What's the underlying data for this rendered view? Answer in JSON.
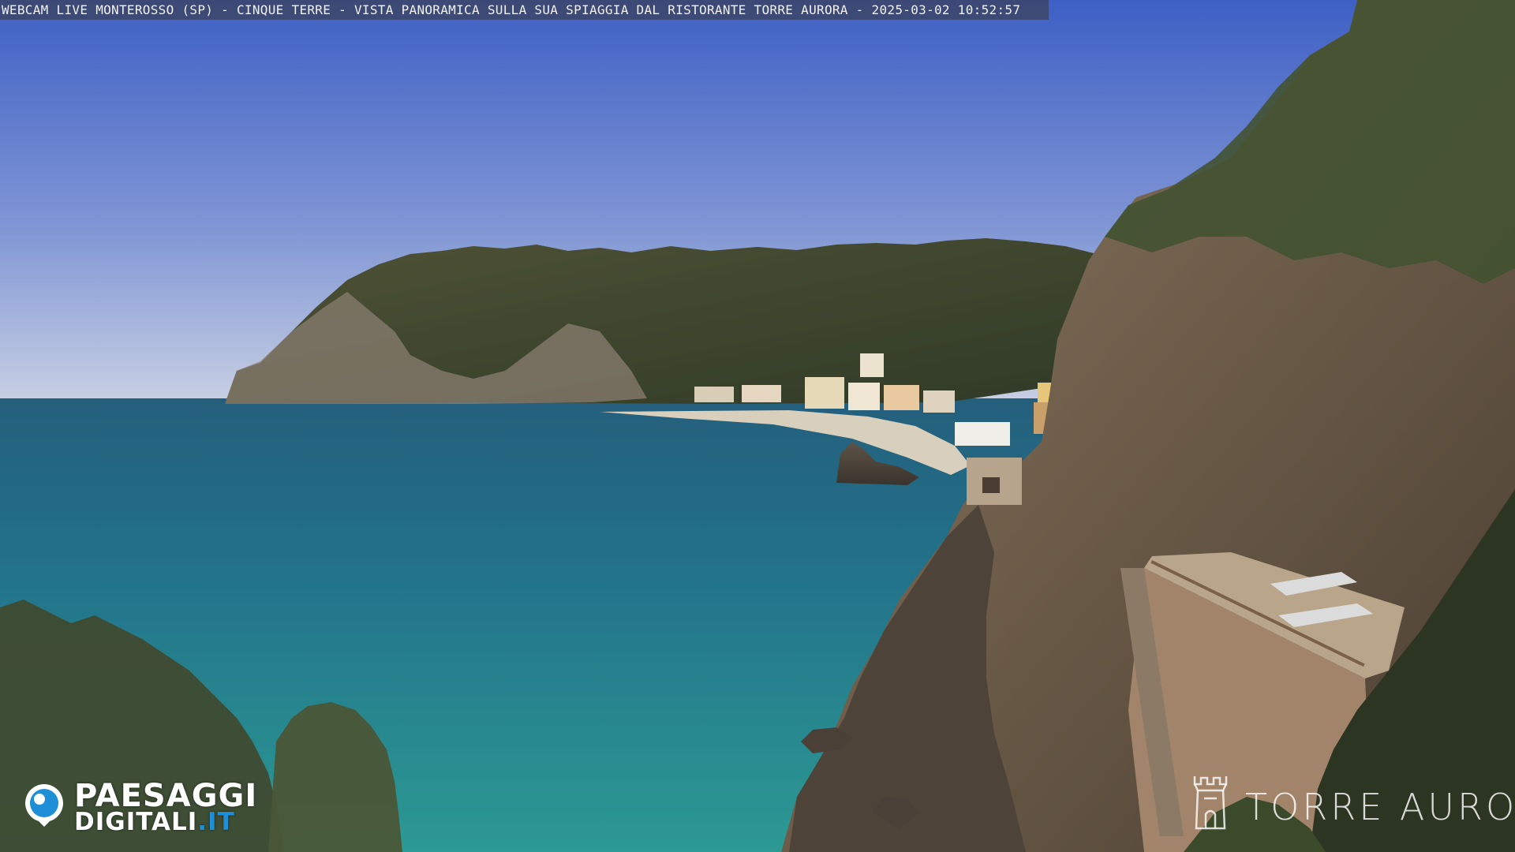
{
  "caption": {
    "text": "WEBCAM LIVE MONTEROSSO (SP) - CINQUE TERRE - VISTA PANORAMICA SULLA SUA SPIAGGIA DAL RISTORANTE TORRE AURORA - 2025-03-02 10:52:57"
  },
  "logo_left": {
    "line1": "PAESAGGI",
    "line2": "DIGITALI",
    "tld": ".IT",
    "icon": "eye-lens-icon"
  },
  "logo_right": {
    "text": "TORRE AURORA",
    "icon": "tower-icon"
  },
  "colors": {
    "sky_top": "#4c69c8",
    "sky_horizon": "#c7cfe3",
    "sea_deep": "#1f6a86",
    "sea_near": "#2a8d92",
    "cliff": "#7d6a55",
    "vegetation": "#3e4a2e",
    "logo_accent": "#1e8fd6"
  }
}
